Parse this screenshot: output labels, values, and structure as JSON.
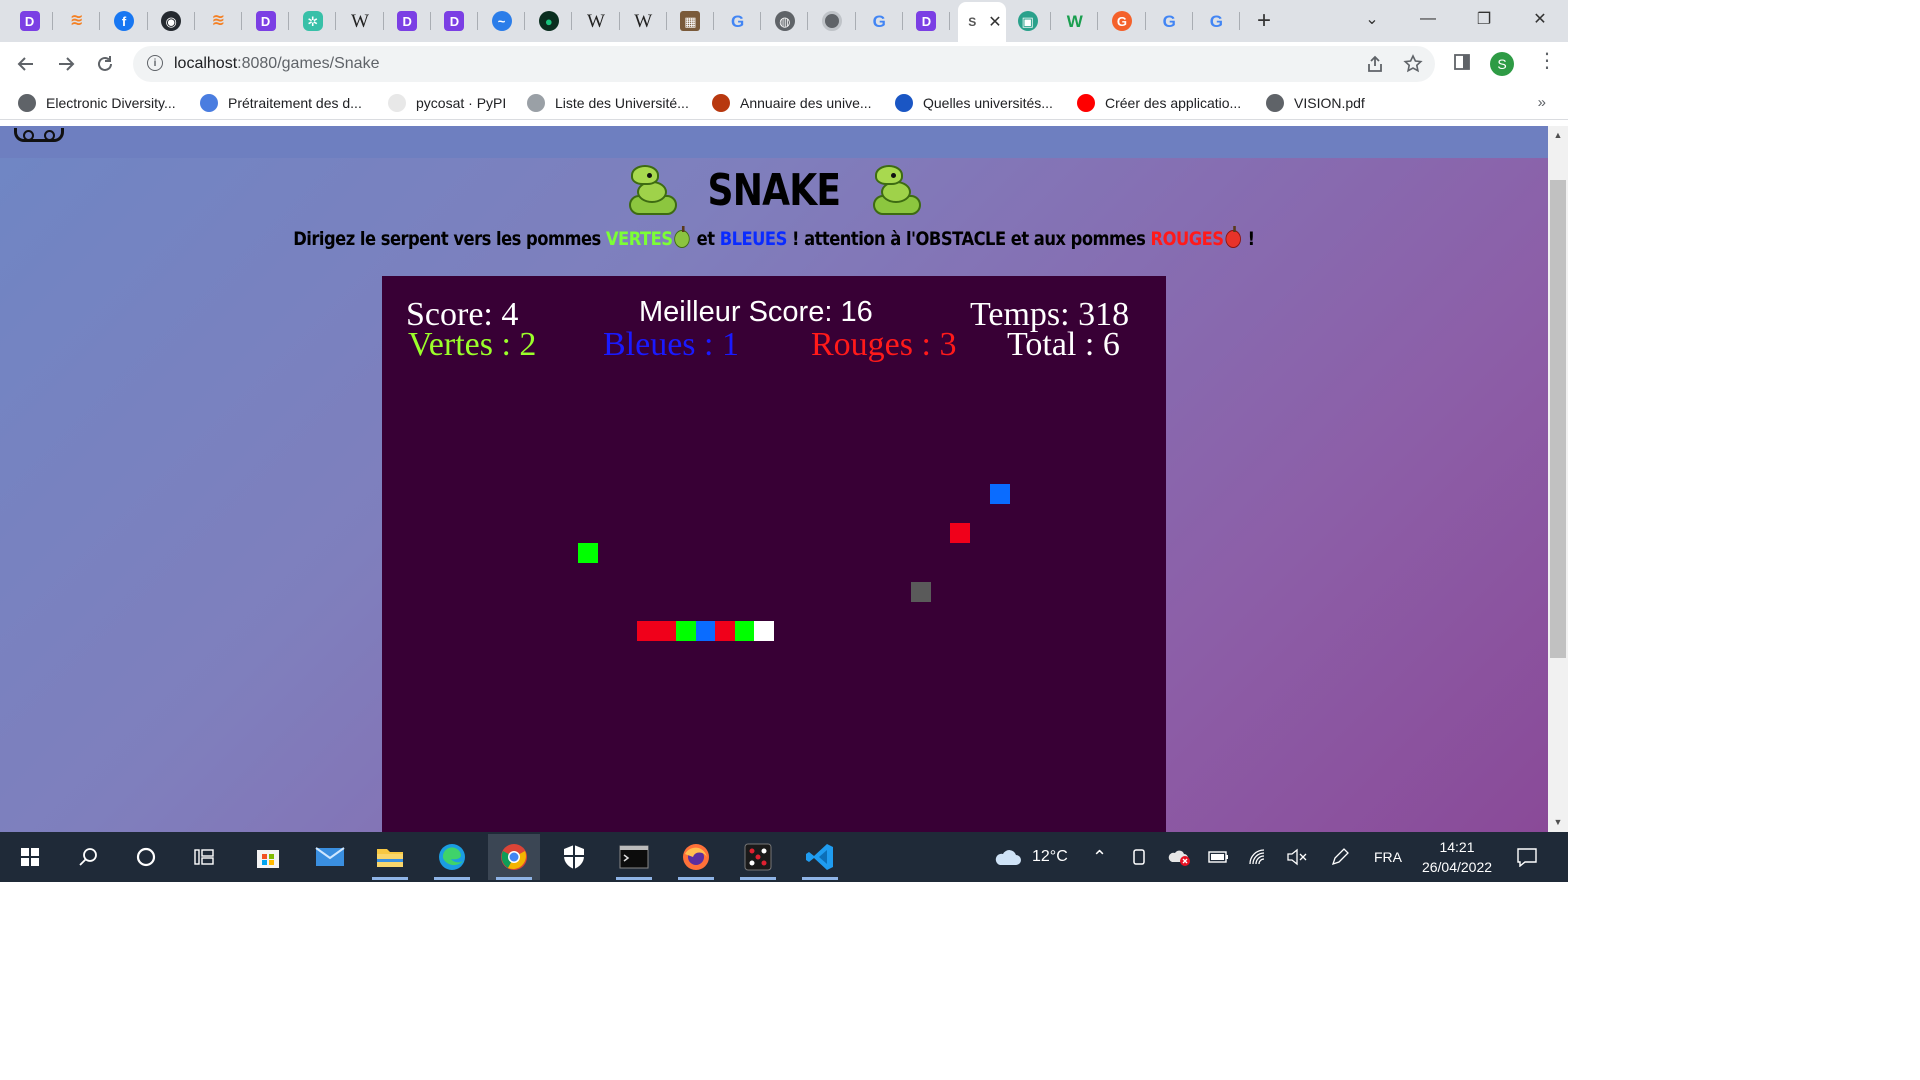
{
  "browser": {
    "tabs": [
      {
        "icon": "deepl-icon",
        "glyph": "D",
        "cls": "purple"
      },
      {
        "icon": "stackoverflow-icon",
        "glyph": "≋",
        "cls": "orange"
      },
      {
        "icon": "facebook-icon",
        "glyph": "f",
        "cls": "fb"
      },
      {
        "icon": "github-icon",
        "glyph": "◉",
        "cls": "gh"
      },
      {
        "icon": "stackoverflow-icon",
        "glyph": "≋",
        "cls": "orange"
      },
      {
        "icon": "deepl-icon",
        "glyph": "D",
        "cls": "purple"
      },
      {
        "icon": "green-app-icon",
        "glyph": "✲",
        "cls": "green"
      },
      {
        "icon": "wikipedia-icon",
        "glyph": "W",
        "cls": "wiki"
      },
      {
        "icon": "deepl-icon",
        "glyph": "D",
        "cls": "purple"
      },
      {
        "icon": "deepl-icon",
        "glyph": "D",
        "cls": "purple"
      },
      {
        "icon": "messenger-icon",
        "glyph": "~",
        "cls": "blue"
      },
      {
        "icon": "leaf-icon",
        "glyph": "●",
        "cls": "dark"
      },
      {
        "icon": "wikipedia-icon",
        "glyph": "W",
        "cls": "wiki"
      },
      {
        "icon": "wikipedia-icon",
        "glyph": "W",
        "cls": "wiki"
      },
      {
        "icon": "picture-icon",
        "glyph": "▦",
        "cls": "pic"
      },
      {
        "icon": "google-icon",
        "glyph": "G",
        "cls": "google"
      },
      {
        "icon": "globe-icon",
        "glyph": "◍",
        "cls": "globe"
      },
      {
        "icon": "chrome-icon",
        "glyph": "",
        "cls": "chrome"
      },
      {
        "icon": "google-icon",
        "glyph": "G",
        "cls": "google"
      },
      {
        "icon": "deepl-icon",
        "glyph": "D",
        "cls": "purple"
      }
    ],
    "active_tab": {
      "icon": "snake-favicon",
      "glyph": "S"
    },
    "tabs_after": [
      {
        "icon": "screen-app-icon",
        "glyph": "▣",
        "cls": "teal"
      },
      {
        "icon": "wikiwand-icon",
        "glyph": "W",
        "cls": "wgreen"
      },
      {
        "icon": "grammarly-icon",
        "glyph": "G",
        "cls": "gorange"
      },
      {
        "icon": "google-icon",
        "glyph": "G",
        "cls": "google"
      },
      {
        "icon": "google-icon",
        "glyph": "G",
        "cls": "google"
      }
    ],
    "url_host": "localhost",
    "url_path": ":8080/games/Snake",
    "profile_initial": "S",
    "bookmarks": [
      {
        "label": "Electronic Diversity...",
        "color": "#5f6368"
      },
      {
        "label": "Prétraitement des d...",
        "color": "#4a7de0"
      },
      {
        "label": "pycosat · PyPI",
        "color": "#e8e8e8"
      },
      {
        "label": "Liste des Université...",
        "color": "#9aa0a6"
      },
      {
        "label": "Annuaire des unive...",
        "color": "#b8380f"
      },
      {
        "label": "Quelles universités...",
        "color": "#1a56c4"
      },
      {
        "label": "Créer des applicatio...",
        "color": "#ff0000"
      },
      {
        "label": "VISION.pdf",
        "color": "#5f6368"
      }
    ]
  },
  "game": {
    "title": "SNAKE",
    "subtitle": {
      "part1": "Dirigez le serpent vers les pommes ",
      "vertes": "VERTES",
      "part2": " et ",
      "bleues": "BLEUES",
      "part3": " ! attention à l'OBSTACLE et aux pommes ",
      "rouges": "ROUGES",
      "part4": " !"
    },
    "hud": {
      "score": "Score: 4",
      "best": "Meilleur Score: 16",
      "time": "Temps: 318",
      "green": "Vertes : 2",
      "blue": "Bleues : 1",
      "red": "Rouges : 3",
      "total": "Total : 6"
    },
    "colors": {
      "board": "#380035",
      "green": "#00ff00",
      "blue": "#0a6cff",
      "red": "#f0001a",
      "obstacle": "#5a5a5a",
      "snake_head": "#ffffff"
    },
    "grid_cells": [
      {
        "kind": "blue-apple",
        "col": 31,
        "row": 10,
        "color": "#0a6cff"
      },
      {
        "kind": "red-apple",
        "col": 29,
        "row": 12,
        "color": "#f0001a"
      },
      {
        "kind": "green-apple",
        "col": 10,
        "row": 13,
        "color": "#00ff00"
      },
      {
        "kind": "obstacle",
        "col": 27,
        "row": 15,
        "color": "#5a5a5a"
      }
    ],
    "snake_segments": [
      {
        "col": 13,
        "row": 17,
        "color": "#f0001a"
      },
      {
        "col": 14,
        "row": 17,
        "color": "#f0001a"
      },
      {
        "col": 15,
        "row": 17,
        "color": "#00ff00"
      },
      {
        "col": 16,
        "row": 17,
        "color": "#0a6cff"
      },
      {
        "col": 17,
        "row": 17,
        "color": "#f0001a"
      },
      {
        "col": 18,
        "row": 17,
        "color": "#00ff00"
      },
      {
        "col": 19,
        "row": 17,
        "color": "#ffffff"
      }
    ]
  },
  "taskbar": {
    "apps": [
      {
        "icon": "windows-start-icon"
      },
      {
        "icon": "search-icon"
      },
      {
        "icon": "cortana-icon"
      },
      {
        "icon": "task-view-icon"
      },
      {
        "icon": "microsoft-store-icon"
      },
      {
        "icon": "mail-icon"
      },
      {
        "icon": "file-explorer-icon"
      },
      {
        "icon": "edge-icon"
      },
      {
        "icon": "chrome-icon"
      },
      {
        "icon": "security-icon"
      },
      {
        "icon": "terminal-icon"
      },
      {
        "icon": "firefox-icon"
      },
      {
        "icon": "dice-app-icon"
      },
      {
        "icon": "vscode-icon"
      }
    ],
    "weather_temp": "12°C",
    "language": "FRA",
    "time": "14:21",
    "date": "26/04/2022"
  }
}
